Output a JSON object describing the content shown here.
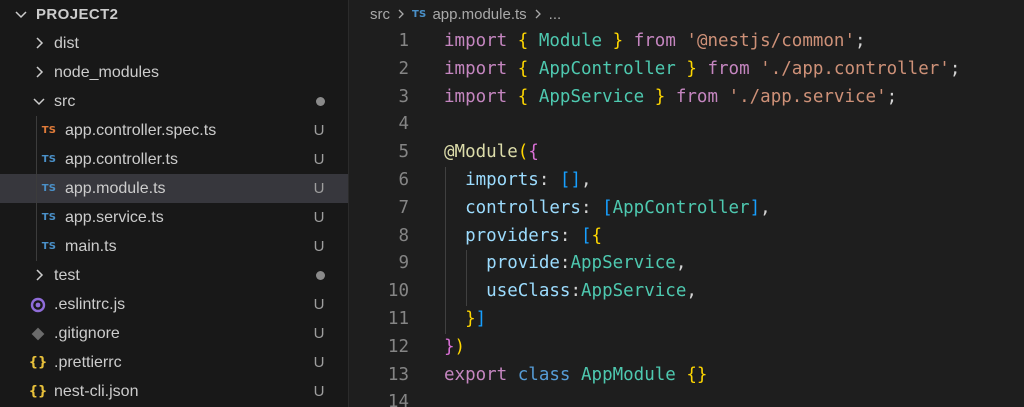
{
  "explorer": {
    "project_title": "PROJECT2",
    "items": [
      {
        "label": "dist",
        "kind": "folder",
        "expanded": false,
        "status": ""
      },
      {
        "label": "node_modules",
        "kind": "folder",
        "expanded": false,
        "status": ""
      },
      {
        "label": "src",
        "kind": "folder",
        "expanded": true,
        "status": "modified-dot"
      },
      {
        "label": "app.controller.spec.ts",
        "kind": "ts-spec",
        "status": "U"
      },
      {
        "label": "app.controller.ts",
        "kind": "ts",
        "status": "U"
      },
      {
        "label": "app.module.ts",
        "kind": "ts",
        "status": "U",
        "selected": true
      },
      {
        "label": "app.service.ts",
        "kind": "ts",
        "status": "U"
      },
      {
        "label": "main.ts",
        "kind": "ts",
        "status": "U"
      },
      {
        "label": "test",
        "kind": "folder",
        "expanded": false,
        "status": "modified-dot"
      },
      {
        "label": ".eslintrc.js",
        "kind": "eslint",
        "status": "U"
      },
      {
        "label": ".gitignore",
        "kind": "git",
        "status": "U"
      },
      {
        "label": ".prettierrc",
        "kind": "json",
        "status": "U"
      },
      {
        "label": "nest-cli.json",
        "kind": "json",
        "status": "U"
      }
    ],
    "ts_badge": "TS",
    "json_badge": "{}"
  },
  "breadcrumb": {
    "folder": "src",
    "file_badge": "TS",
    "file": "app.module.ts",
    "more": "..."
  },
  "editor": {
    "lines": [
      {
        "n": "1",
        "tokens": [
          [
            "kw",
            "import"
          ],
          [
            "pn",
            " "
          ],
          [
            "br1",
            "{"
          ],
          [
            "pn",
            " "
          ],
          [
            "id",
            "Module"
          ],
          [
            "pn",
            " "
          ],
          [
            "br1",
            "}"
          ],
          [
            "pn",
            " "
          ],
          [
            "kw",
            "from"
          ],
          [
            "pn",
            " "
          ],
          [
            "str",
            "'@nestjs/common'"
          ],
          [
            "pn",
            ";"
          ]
        ]
      },
      {
        "n": "2",
        "tokens": [
          [
            "kw",
            "import"
          ],
          [
            "pn",
            " "
          ],
          [
            "br1",
            "{"
          ],
          [
            "pn",
            " "
          ],
          [
            "id",
            "AppController"
          ],
          [
            "pn",
            " "
          ],
          [
            "br1",
            "}"
          ],
          [
            "pn",
            " "
          ],
          [
            "kw",
            "from"
          ],
          [
            "pn",
            " "
          ],
          [
            "str",
            "'./app.controller'"
          ],
          [
            "pn",
            ";"
          ]
        ]
      },
      {
        "n": "3",
        "tokens": [
          [
            "kw",
            "import"
          ],
          [
            "pn",
            " "
          ],
          [
            "br1",
            "{"
          ],
          [
            "pn",
            " "
          ],
          [
            "id",
            "AppService"
          ],
          [
            "pn",
            " "
          ],
          [
            "br1",
            "}"
          ],
          [
            "pn",
            " "
          ],
          [
            "kw",
            "from"
          ],
          [
            "pn",
            " "
          ],
          [
            "str",
            "'./app.service'"
          ],
          [
            "pn",
            ";"
          ]
        ]
      },
      {
        "n": "4",
        "tokens": []
      },
      {
        "n": "5",
        "tokens": [
          [
            "fn",
            "@Module"
          ],
          [
            "br1",
            "("
          ],
          [
            "br2",
            "{"
          ]
        ]
      },
      {
        "n": "6",
        "indent": 1,
        "tokens": [
          [
            "pn",
            "  "
          ],
          [
            "prop",
            "imports"
          ],
          [
            "pn",
            ": "
          ],
          [
            "br3",
            "[]"
          ],
          [
            "pn",
            ","
          ]
        ]
      },
      {
        "n": "7",
        "indent": 1,
        "tokens": [
          [
            "pn",
            "  "
          ],
          [
            "prop",
            "controllers"
          ],
          [
            "pn",
            ": "
          ],
          [
            "br3",
            "["
          ],
          [
            "id",
            "AppController"
          ],
          [
            "br3",
            "]"
          ],
          [
            "pn",
            ","
          ]
        ]
      },
      {
        "n": "8",
        "indent": 1,
        "tokens": [
          [
            "pn",
            "  "
          ],
          [
            "prop",
            "providers"
          ],
          [
            "pn",
            ": "
          ],
          [
            "br3",
            "["
          ],
          [
            "br1",
            "{"
          ]
        ]
      },
      {
        "n": "9",
        "indent": 2,
        "tokens": [
          [
            "pn",
            "    "
          ],
          [
            "prop",
            "provide"
          ],
          [
            "pn",
            ":"
          ],
          [
            "id",
            "AppService"
          ],
          [
            "pn",
            ","
          ]
        ]
      },
      {
        "n": "10",
        "indent": 2,
        "tokens": [
          [
            "pn",
            "    "
          ],
          [
            "prop",
            "useClass"
          ],
          [
            "pn",
            ":"
          ],
          [
            "id",
            "AppService"
          ],
          [
            "pn",
            ","
          ]
        ]
      },
      {
        "n": "11",
        "indent": 1,
        "tokens": [
          [
            "pn",
            "  "
          ],
          [
            "br1",
            "}"
          ],
          [
            "br3",
            "]"
          ]
        ]
      },
      {
        "n": "12",
        "tokens": [
          [
            "br2",
            "}"
          ],
          [
            "br1",
            ")"
          ]
        ]
      },
      {
        "n": "13",
        "tokens": [
          [
            "kw",
            "export"
          ],
          [
            "pn",
            " "
          ],
          [
            "kw2",
            "class"
          ],
          [
            "pn",
            " "
          ],
          [
            "id",
            "AppModule"
          ],
          [
            "pn",
            " "
          ],
          [
            "br1",
            "{}"
          ]
        ]
      },
      {
        "n": "14",
        "tokens": []
      }
    ]
  },
  "colors": {
    "ts_blue": "#4a90c8",
    "ts_spec_orange": "#e07b39",
    "eslint_purple": "#8f6cd8",
    "json_yellow": "#e8c13b",
    "git_gray": "#6b6b6b"
  }
}
